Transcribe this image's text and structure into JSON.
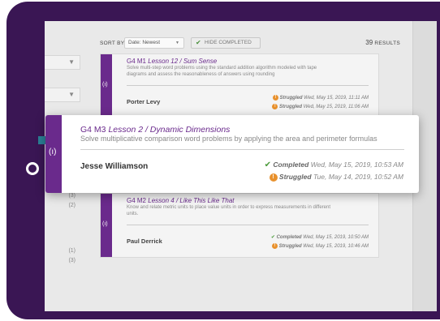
{
  "toolbar": {
    "sort_label": "SORT BY",
    "sort_value": "Date: Newest",
    "hide_completed": "HIDE COMPLETED",
    "results_count": "39",
    "results_label": "RESULTS"
  },
  "sidebar": {
    "counts": [
      "(3)",
      "(2)",
      "(1)",
      "(3)"
    ]
  },
  "cards": [
    {
      "module": "G4 M1",
      "lesson": "Lesson 12 / Sum Sense",
      "description": "Solve multi-step word problems using the standard addition algorithm modeled with tape diagrams and assess the reasonableness of answers using rounding",
      "student": "Porter Levy",
      "status1_label": "Struggled",
      "status1_time": "Wed, May 15, 2019, 11:11 AM",
      "status2_label": "Struggled",
      "status2_time": "Wed, May 15, 2019, 11:06 AM"
    },
    {
      "module": "G4 M2",
      "lesson": "Lesson 4 / Like This Like That",
      "description": "Know and relate metric units to place value units in order to express measurements in different units.",
      "student": "Paul Derrick",
      "status1_label": "Completed",
      "status1_time": "Wed, May 15, 2019, 10:50 AM",
      "status2_label": "Struggled",
      "status2_time": "Wed, May 15, 2019, 10:46 AM"
    }
  ],
  "focus_card": {
    "module": "G4 M3",
    "lesson": "Lesson 2 / Dynamic Dimensions",
    "description": "Solve multiplicative comparison word problems by applying the area and perimeter formulas",
    "student": "Jesse Williamson",
    "status1_label": "Completed",
    "status1_time": "Wed, May 15, 2019, 10:53 AM",
    "status2_label": "Struggled",
    "status2_time": "Tue, May 14, 2019, 10:52 AM"
  },
  "icons": {
    "signal": "(ı)",
    "check": "✔",
    "warn": "!",
    "caret": "▼"
  },
  "colors": {
    "device": "#3a1654",
    "accent_purple": "#6a2a8c",
    "completed_green": "#4a9a3a",
    "struggled_orange": "#e8912d"
  }
}
